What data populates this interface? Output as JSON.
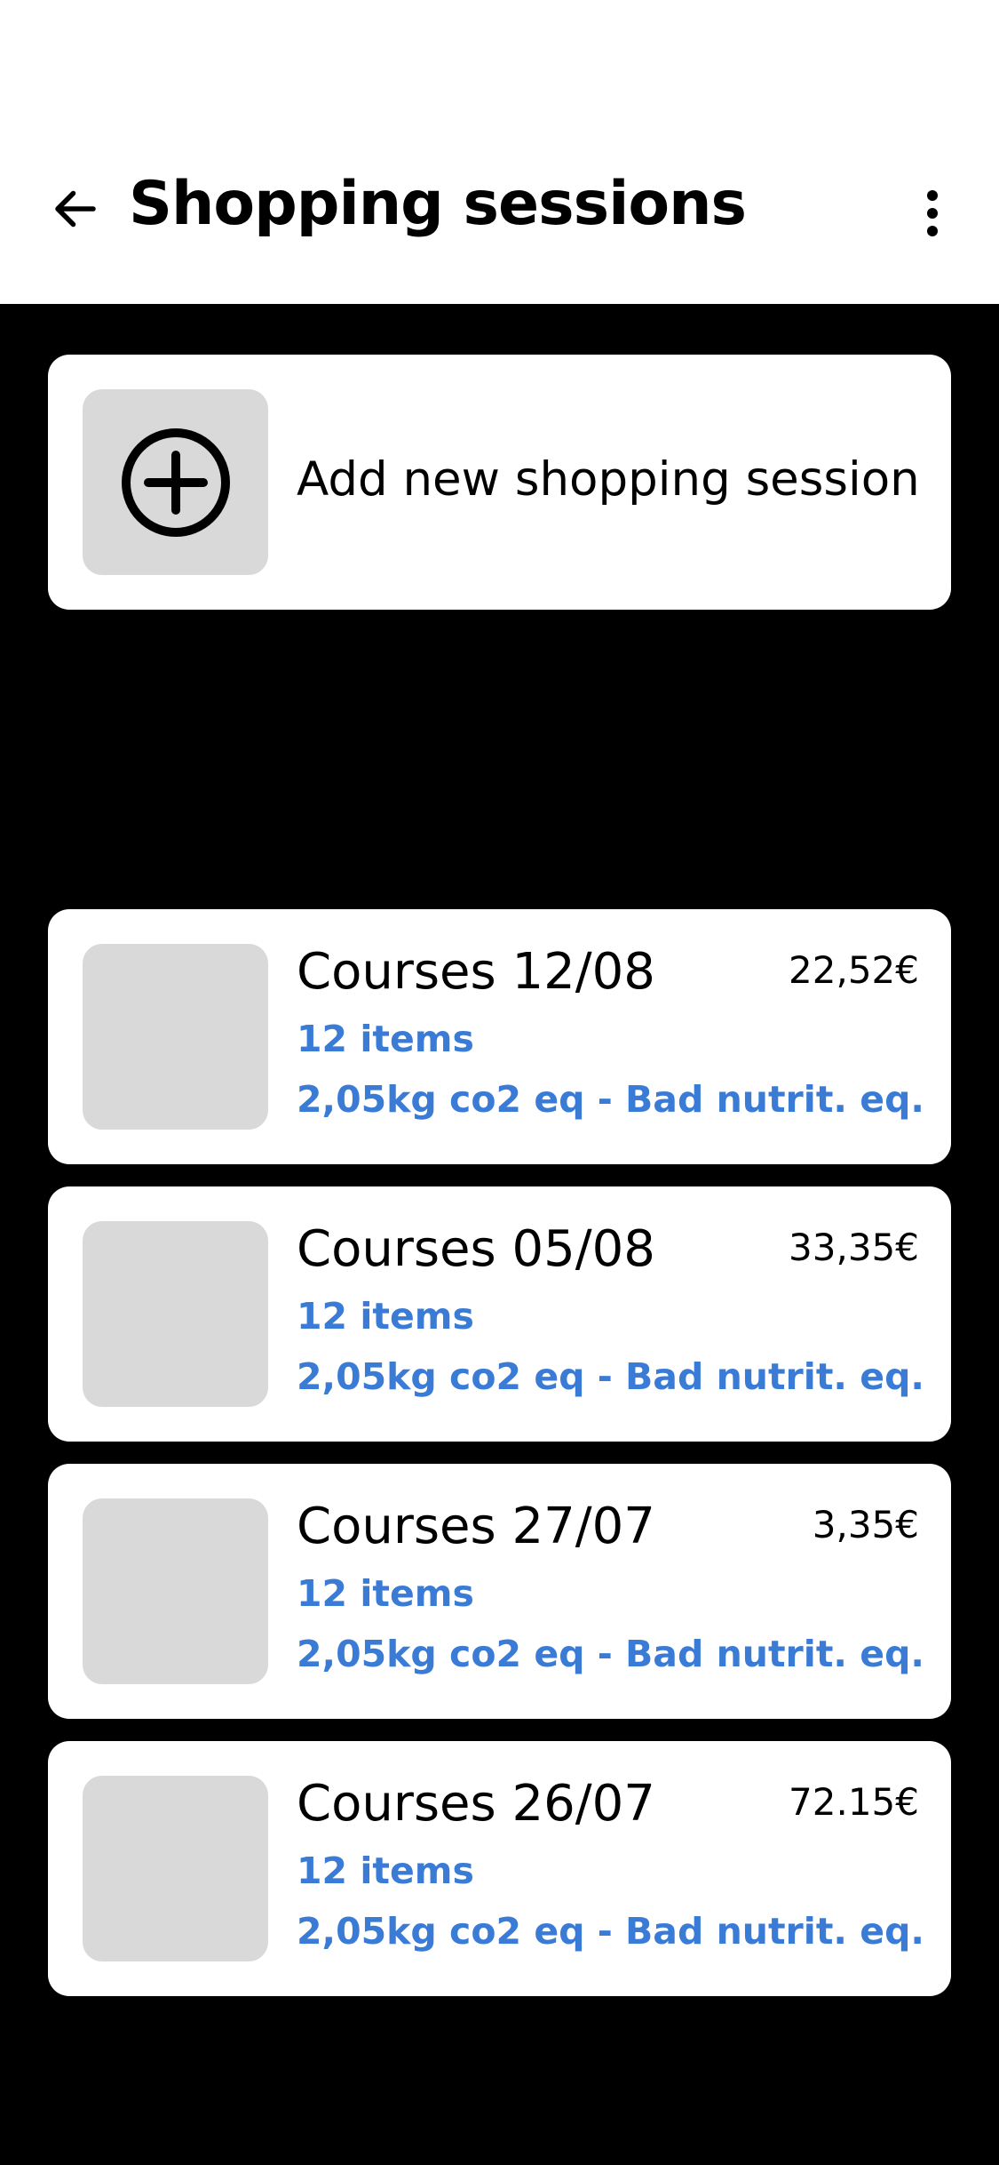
{
  "header": {
    "title": "Shopping sessions",
    "back_icon": "arrow-left-icon",
    "more_icon": "more-vertical-icon"
  },
  "add_session": {
    "label": "Add new shopping session",
    "icon": "plus-circle-icon"
  },
  "sessions": [
    {
      "title": "Courses 12/08",
      "price": "22,52€",
      "items": "12 items",
      "impact": "2,05kg co2 eq - Bad nutrit. eq."
    },
    {
      "title": "Courses 05/08",
      "price": "33,35€",
      "items": "12 items",
      "impact": "2,05kg co2 eq - Bad nutrit. eq."
    },
    {
      "title": "Courses 27/07",
      "price": "3,35€",
      "items": "12 items",
      "impact": "2,05kg co2 eq - Bad nutrit. eq."
    },
    {
      "title": "Courses 26/07",
      "price": "72.15€",
      "items": "12 items",
      "impact": "2,05kg co2 eq - Bad nutrit. eq."
    }
  ],
  "colors": {
    "background": "#000000",
    "card": "#ffffff",
    "thumbnail": "#d9d9d9",
    "accent": "#3a7bd5"
  }
}
